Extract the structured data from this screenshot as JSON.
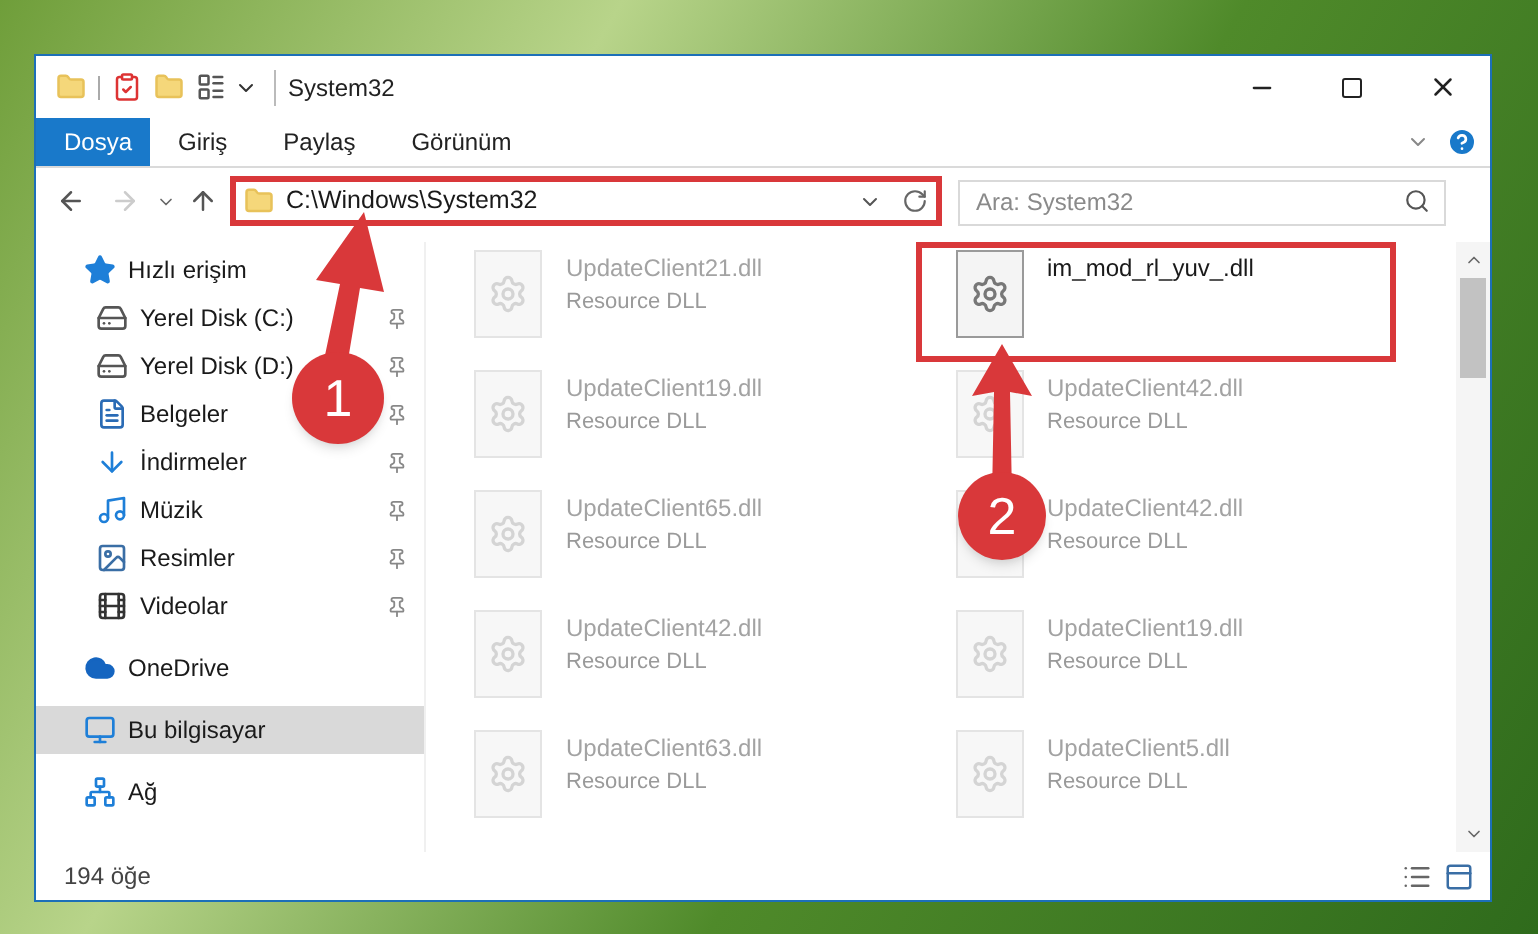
{
  "window": {
    "title": "System32"
  },
  "ribbon_tabs": [
    {
      "label": "Dosya",
      "selected": true
    },
    {
      "label": "Giriş",
      "selected": false
    },
    {
      "label": "Paylaş",
      "selected": false
    },
    {
      "label": "Görünüm",
      "selected": false
    }
  ],
  "address_bar": {
    "path": "C:\\Windows\\System32",
    "highlighted": true
  },
  "search": {
    "placeholder": "Ara: System32"
  },
  "sidebar": {
    "items": [
      {
        "label": "Hızlı erişim",
        "kind": "star",
        "selected": false,
        "children": [
          {
            "label": "Yerel Disk (C:)",
            "kind": "disk-c",
            "pinned": true,
            "selected": false
          },
          {
            "label": "Yerel Disk (D:)",
            "kind": "disk",
            "pinned": true,
            "selected": false
          },
          {
            "label": "Belgeler",
            "kind": "documents",
            "pinned": true,
            "selected": false
          },
          {
            "label": "İndirmeler",
            "kind": "downloads",
            "pinned": true,
            "selected": false
          },
          {
            "label": "Müzik",
            "kind": "music",
            "pinned": true,
            "selected": false
          },
          {
            "label": "Resimler",
            "kind": "pictures",
            "pinned": true,
            "selected": false
          },
          {
            "label": "Videolar",
            "kind": "videos",
            "pinned": true,
            "selected": false
          }
        ]
      },
      {
        "label": "OneDrive",
        "kind": "cloud",
        "selected": false
      },
      {
        "label": "Bu bilgisayar",
        "kind": "computer",
        "selected": true
      },
      {
        "label": "Ağ",
        "kind": "network",
        "selected": false
      }
    ]
  },
  "files": [
    {
      "name": "UpdateClient21.dll",
      "type": "Resource DLL",
      "faded": true,
      "highlighted": false
    },
    {
      "name": "im_mod_rl_yuv_.dll",
      "faded": false,
      "highlighted": true
    },
    {
      "name": "UpdateClient19.dll",
      "type": "Resource DLL",
      "faded": true,
      "highlighted": false
    },
    {
      "name": "UpdateClient42.dll",
      "type": "Resource DLL",
      "faded": true,
      "highlighted": false
    },
    {
      "name": "UpdateClient65.dll",
      "type": "Resource DLL",
      "faded": true,
      "highlighted": false
    },
    {
      "name": "UpdateClient42.dll",
      "type": "Resource DLL",
      "faded": true,
      "highlighted": false
    },
    {
      "name": "UpdateClient42.dll",
      "type": "Resource DLL",
      "faded": true,
      "highlighted": false
    },
    {
      "name": "UpdateClient19.dll",
      "type": "Resource DLL",
      "faded": true,
      "highlighted": false
    },
    {
      "name": "UpdateClient63.dll",
      "type": "Resource DLL",
      "faded": true,
      "highlighted": false
    },
    {
      "name": "UpdateClient5.dll",
      "type": "Resource DLL",
      "faded": true,
      "highlighted": false
    }
  ],
  "status_bar": {
    "count": "194 öğe"
  },
  "callouts": [
    {
      "number": "1"
    },
    {
      "number": "2"
    }
  ]
}
